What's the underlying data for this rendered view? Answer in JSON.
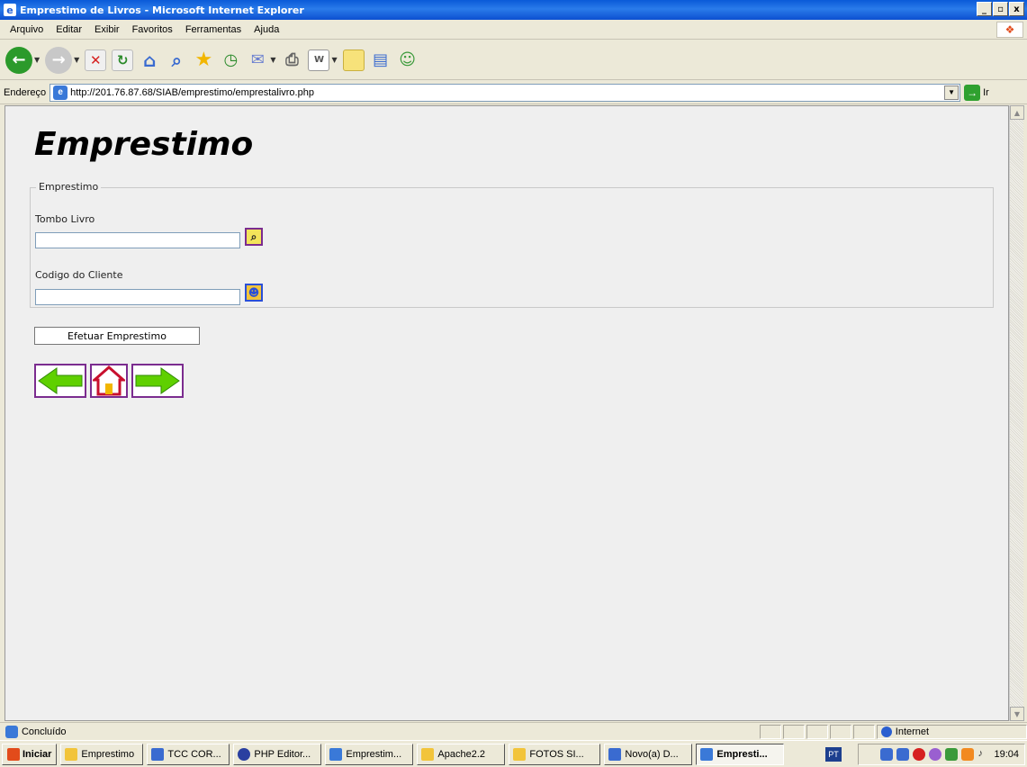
{
  "window": {
    "title": "Emprestimo de Livros - Microsoft Internet Explorer",
    "buttons": {
      "minimize": "_",
      "maximize": "▫",
      "close": "x"
    }
  },
  "menu": {
    "items": [
      "Arquivo",
      "Editar",
      "Exibir",
      "Favoritos",
      "Ferramentas",
      "Ajuda"
    ]
  },
  "address": {
    "label": "Endereço",
    "url": "http://201.76.87.68/SIAB/emprestimo/emprestalivro.php",
    "go_label": "Ir"
  },
  "page": {
    "title": "Emprestimo",
    "fieldset_legend": "Emprestimo",
    "tombo_label": "Tombo Livro",
    "tombo_value": "",
    "cliente_label": "Codigo do Cliente",
    "cliente_value": "",
    "submit_label": "Efetuar Emprestimo"
  },
  "status": {
    "text": "Concluído",
    "zone": "Internet"
  },
  "taskbar": {
    "start_label": "Iniciar",
    "tasks": [
      "Emprestimo",
      "TCC COR...",
      "PHP Editor...",
      "Emprestim...",
      "Apache2.2",
      "FOTOS SI...",
      "Novo(a) D...",
      "Empresti..."
    ],
    "lang": "PT",
    "clock": "19:04"
  },
  "colors": {
    "nav_border": "#7b2c8f",
    "arrow_green": "#5fd000",
    "home_red": "#c8102e"
  }
}
